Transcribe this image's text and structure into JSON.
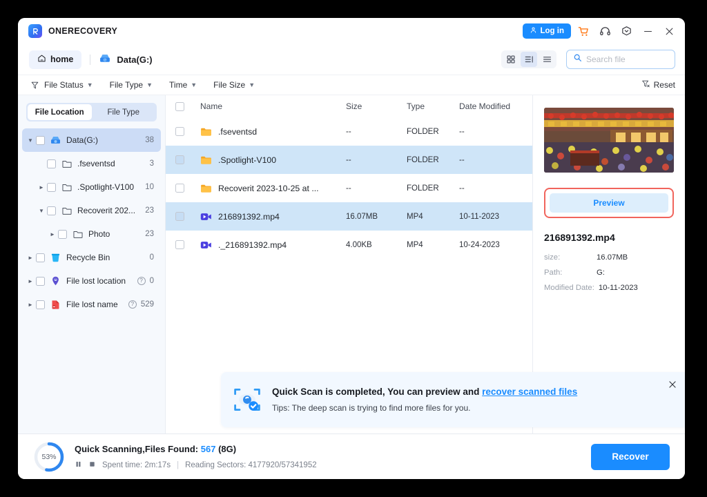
{
  "app": {
    "brand": "ONERECOVERY",
    "logo_icon": "app-logo-icon"
  },
  "titlebar": {
    "login_label": "Log in",
    "login_icon": "user-icon",
    "cart_icon": "cart-icon",
    "support_icon": "headset-icon",
    "settings_icon": "gear-icon",
    "minimize_icon": "minimize-icon",
    "close_icon": "close-icon"
  },
  "nav": {
    "home_label": "home",
    "home_icon": "home-icon",
    "drive_label": "Data(G:)",
    "drive_icon": "drive-icon",
    "views": [
      {
        "name": "grid-view",
        "icon": "grid-icon",
        "active": false
      },
      {
        "name": "detail-view",
        "icon": "detail-list-icon",
        "active": true
      },
      {
        "name": "list-view",
        "icon": "list-icon",
        "active": false
      }
    ],
    "search_placeholder": "Search file",
    "search_value": "",
    "search_icon": "search-icon"
  },
  "filters": {
    "funnel_icon": "filter-icon",
    "items": [
      {
        "label": "File Status"
      },
      {
        "label": "File Type"
      },
      {
        "label": "Time"
      },
      {
        "label": "File Size"
      }
    ],
    "reset_label": "Reset",
    "reset_icon": "filter-reset-icon"
  },
  "sidebar": {
    "tabs": [
      {
        "label": "File Location",
        "active": true
      },
      {
        "label": "File Type",
        "active": false
      }
    ],
    "tree": [
      {
        "label": "Data(G:)",
        "count": "38",
        "indent": 0,
        "twisty": "down",
        "icon": "drive-icon",
        "selected": true,
        "help": false
      },
      {
        "label": ".fseventsd",
        "count": "3",
        "indent": 1,
        "twisty": "none",
        "icon": "folder-outline-icon",
        "selected": false,
        "help": false
      },
      {
        "label": ".Spotlight-V100",
        "count": "10",
        "indent": 1,
        "twisty": "right",
        "icon": "folder-outline-icon",
        "selected": false,
        "help": false
      },
      {
        "label": "Recoverit 202...",
        "count": "23",
        "indent": 1,
        "twisty": "down",
        "icon": "folder-outline-icon",
        "selected": false,
        "help": false
      },
      {
        "label": "Photo",
        "count": "23",
        "indent": 2,
        "twisty": "right",
        "icon": "folder-outline-icon",
        "selected": false,
        "help": false
      },
      {
        "label": "Recycle Bin",
        "count": "0",
        "indent": 0,
        "twisty": "right",
        "icon": "trash-icon",
        "selected": false,
        "help": false
      },
      {
        "label": "File lost location",
        "count": "0",
        "indent": 0,
        "twisty": "right",
        "icon": "lost-location-icon",
        "selected": false,
        "help": true
      },
      {
        "label": "File lost name",
        "count": "529",
        "indent": 0,
        "twisty": "right",
        "icon": "lost-name-icon",
        "selected": false,
        "help": true
      }
    ]
  },
  "filelist": {
    "columns": [
      "Name",
      "Size",
      "Type",
      "Date Modified"
    ],
    "rows": [
      {
        "name": ".fseventsd",
        "size": "--",
        "type": "FOLDER",
        "date": "--",
        "icon": "folder-icon",
        "selected": false
      },
      {
        "name": ".Spotlight-V100",
        "size": "--",
        "type": "FOLDER",
        "date": "--",
        "icon": "folder-icon",
        "selected": true
      },
      {
        "name": "Recoverit 2023-10-25 at ...",
        "size": "--",
        "type": "FOLDER",
        "date": "--",
        "icon": "folder-icon",
        "selected": false
      },
      {
        "name": "216891392.mp4",
        "size": "16.07MB",
        "type": "MP4",
        "date": "10-11-2023",
        "icon": "video-icon",
        "selected": true
      },
      {
        "name": "._216891392.mp4",
        "size": "4.00KB",
        "type": "MP4",
        "date": "10-24-2023",
        "icon": "video-icon",
        "selected": false
      }
    ]
  },
  "preview": {
    "thumbnail_name": "video-thumbnail",
    "button_label": "Preview",
    "file_name": "216891392.mp4",
    "meta": [
      {
        "key": "size:",
        "value": "16.07MB"
      },
      {
        "key": "Path:",
        "value": "G:"
      },
      {
        "key": "Modified Date:",
        "value": "10-11-2023"
      }
    ]
  },
  "notification": {
    "icon": "scan-complete-icon",
    "title_pre": "Quick Scan",
    "title_mid": " is completed, You can preview and ",
    "title_link": "recover scanned files",
    "tip": "Tips: The deep scan is trying to find more files for you.",
    "close_icon": "close-icon"
  },
  "footer": {
    "progress_percent": "53%",
    "progress_value": 53,
    "status_pre": "Quick Scanning,Files Found:  ",
    "files_found": "567",
    "status_post": " (8G)",
    "pause_icon": "pause-icon",
    "stop_icon": "stop-icon",
    "spent_time": "Spent time: 2m:17s",
    "separator": "|",
    "sectors": "Reading Sectors: 4177920/57341952",
    "recover_label": "Recover"
  },
  "colors": {
    "accent": "#1a8cff",
    "highlight_row": "#cfe5f8",
    "sidebar_selected": "#ccdcf6",
    "preview_outline": "#f1645c",
    "cart": "#ff7a18"
  }
}
